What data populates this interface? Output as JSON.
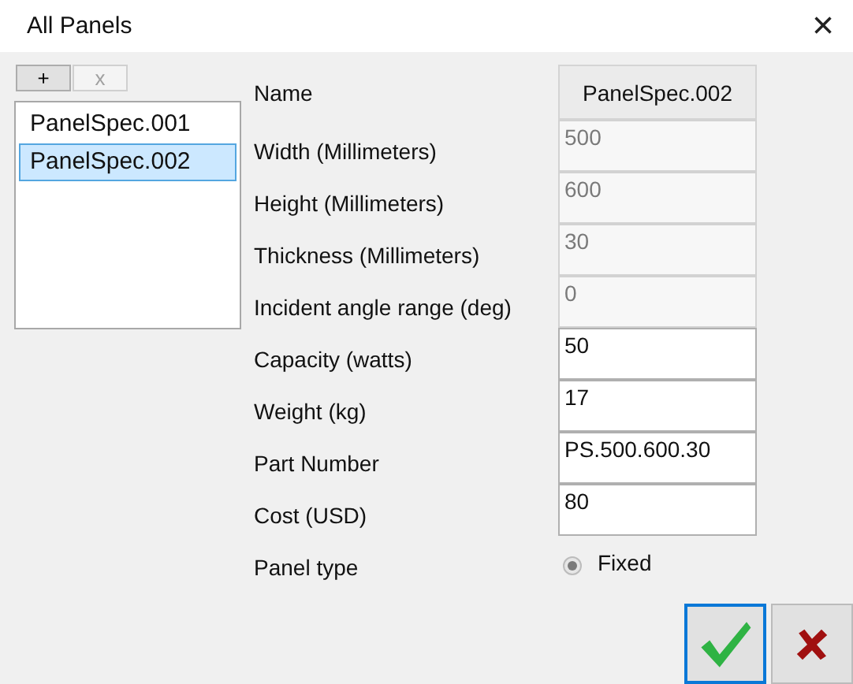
{
  "window": {
    "title": "All Panels",
    "close": "×"
  },
  "list_buttons": [
    {
      "label": "+",
      "disabled": false
    },
    {
      "label": "x",
      "disabled": true
    }
  ],
  "list": [
    {
      "label": "PanelSpec.001",
      "selected": false
    },
    {
      "label": "PanelSpec.002",
      "selected": true
    }
  ],
  "fields": [
    {
      "kind": "header",
      "label": "Name",
      "value": "PanelSpec.002"
    },
    {
      "kind": "text",
      "label": "Width (Millimeters)",
      "value": "500",
      "disabled": true
    },
    {
      "kind": "text",
      "label": "Height (Millimeters)",
      "value": "600",
      "disabled": true
    },
    {
      "kind": "text",
      "label": "Thickness (Millimeters)",
      "value": "30",
      "disabled": true
    },
    {
      "kind": "text",
      "label": "Incident angle range (deg)",
      "value": "0",
      "disabled": true
    },
    {
      "kind": "text",
      "label": "Capacity (watts)",
      "value": "50",
      "disabled": false
    },
    {
      "kind": "text",
      "label": "Weight (kg)",
      "value": "17",
      "disabled": false
    },
    {
      "kind": "text",
      "label": "Part Number",
      "value": "PS.500.600.30",
      "disabled": false
    },
    {
      "kind": "text",
      "label": "Cost (USD)",
      "value": "80",
      "disabled": false
    },
    {
      "kind": "radio",
      "label": "Panel type",
      "option": "Fixed",
      "selected": true,
      "disabled": true
    }
  ],
  "buttons": [
    {
      "kind": "ok",
      "focused": true
    },
    {
      "kind": "cancel",
      "focused": false
    }
  ]
}
